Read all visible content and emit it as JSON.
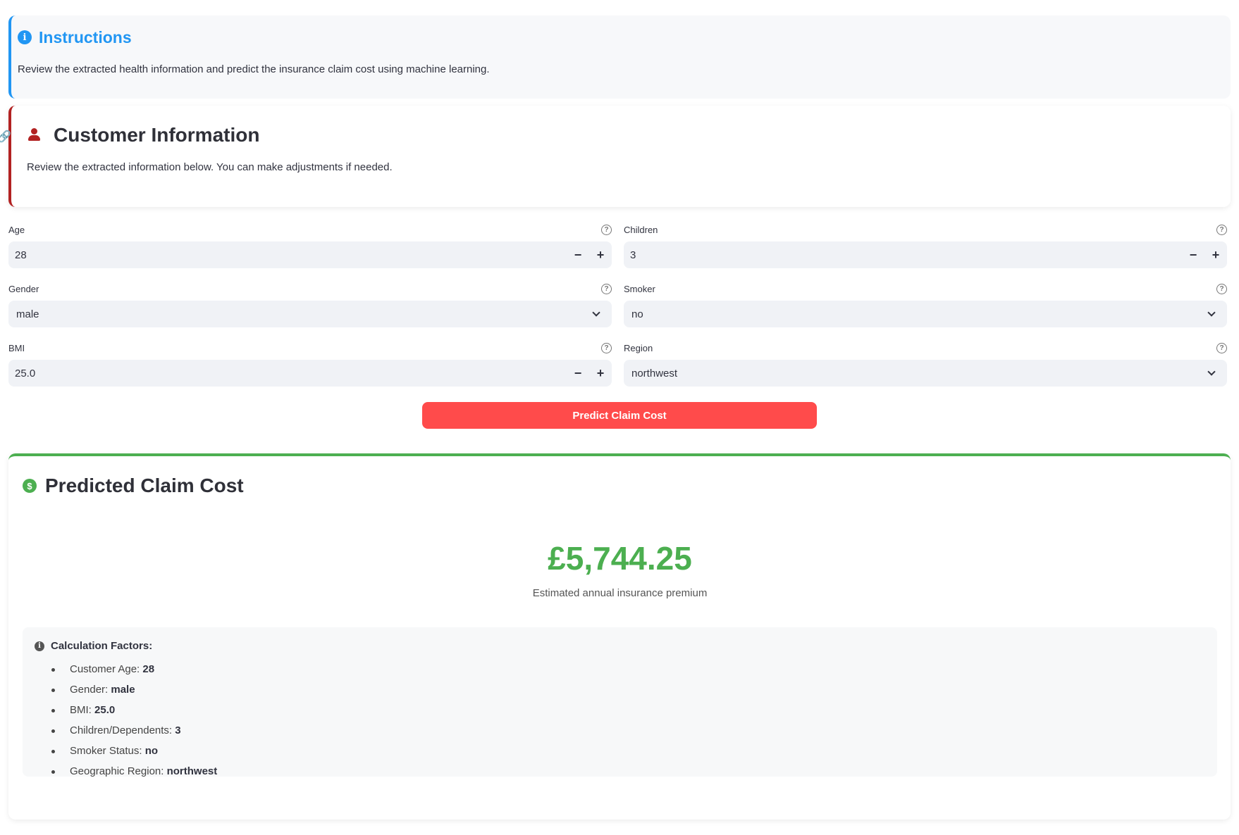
{
  "instructions": {
    "title": "Instructions",
    "text": "Review the extracted health information and predict the insurance claim cost using machine learning."
  },
  "customer": {
    "title": "Customer Information",
    "text": "Review the extracted information below. You can make adjustments if needed."
  },
  "form": {
    "age": {
      "label": "Age",
      "value": "28"
    },
    "children": {
      "label": "Children",
      "value": "3"
    },
    "gender": {
      "label": "Gender",
      "value": "male"
    },
    "smoker": {
      "label": "Smoker",
      "value": "no"
    },
    "bmi": {
      "label": "BMI",
      "value": "25.0"
    },
    "region": {
      "label": "Region",
      "value": "northwest"
    },
    "minus": "−",
    "plus": "+",
    "help": "?"
  },
  "predict_button": "Predict Claim Cost",
  "result": {
    "title": "Predicted Claim Cost",
    "amount": "£5,744.25",
    "subtitle": "Estimated annual insurance premium",
    "factors_title": "Calculation Factors:",
    "factors": [
      {
        "label": "Customer Age:",
        "value": "28"
      },
      {
        "label": "Gender:",
        "value": "male"
      },
      {
        "label": "BMI:",
        "value": "25.0"
      },
      {
        "label": "Children/Dependents:",
        "value": "3"
      },
      {
        "label": "Smoker Status:",
        "value": "no"
      },
      {
        "label": "Geographic Region:",
        "value": "northwest"
      }
    ]
  },
  "icons": {
    "info": "i",
    "dollar": "$",
    "link": "🔗"
  },
  "colors": {
    "info_blue": "#2196f3",
    "customer_red": "#b22222",
    "button_red": "#ff4b4b",
    "success_green": "#4caf50",
    "input_bg": "#f0f2f6"
  }
}
